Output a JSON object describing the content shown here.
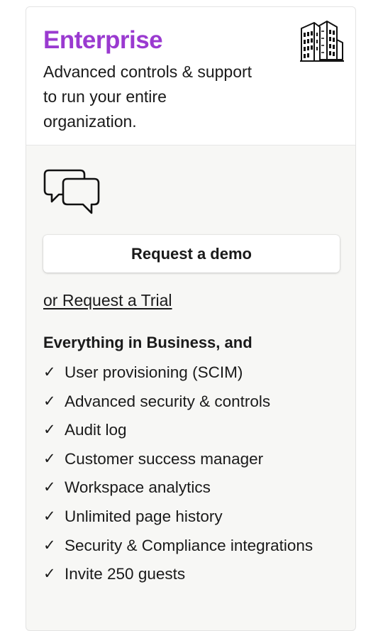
{
  "plan": {
    "title": "Enterprise",
    "description": "Advanced controls & support to run your entire organization.",
    "title_color": "#9a3ad0",
    "icon": "building-icon"
  },
  "actions": {
    "demo_icon": "chat-bubbles-icon",
    "demo_label": "Request a demo",
    "trial_label": "or Request a Trial"
  },
  "features": {
    "heading": "Everything in Business, and",
    "check_glyph": "✓",
    "items": [
      "User provisioning (SCIM)",
      "Advanced security & controls",
      "Audit log",
      "Customer success manager",
      "Workspace analytics",
      "Unlimited page history",
      "Security & Compliance integrations",
      "Invite 250 guests"
    ]
  }
}
